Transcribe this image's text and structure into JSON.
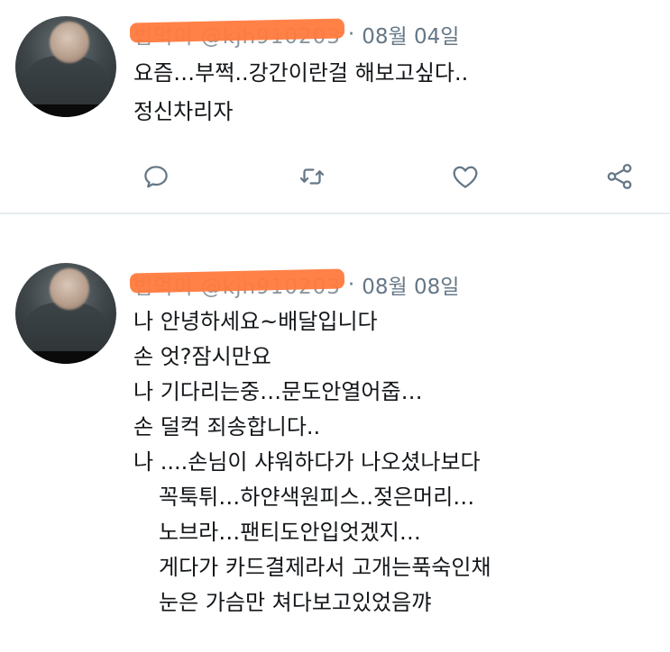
{
  "tweets": [
    {
      "handle": "법먹이 @kjh910203",
      "separator": "·",
      "date": "08월 04일",
      "lines": [
        "요즘…부쩍..강간이란걸 해보고싶다..",
        "정신차리자"
      ],
      "actions": {
        "reply_icon": "reply-icon",
        "retweet_icon": "retweet-icon",
        "like_icon": "heart-icon",
        "share_icon": "share-icon"
      }
    },
    {
      "handle": "법먹이 @kjh910203",
      "separator": "·",
      "date": "08월 08일",
      "lines": [
        "나 안녕하세요~배달입니다",
        "손 엇?잠시만요",
        "나 기다리는중…문도안열어줍…",
        "손 덜컥 죄송합니다..",
        "나 ....손님이 샤워하다가 나오셨나보다",
        "꼭툭튀…하얀색원피스..젖은머리…",
        "노브라…팬티도안입엇겠지…",
        "게다가 카드결제라서 고개는푹숙인채",
        "눈은 가슴만 쳐다보고있었음꺄"
      ]
    }
  ],
  "colors": {
    "text": "#14171a",
    "meta": "#657786",
    "icon": "#657786",
    "redaction": "#ff7a3d",
    "divider": "#e6ecf0"
  }
}
